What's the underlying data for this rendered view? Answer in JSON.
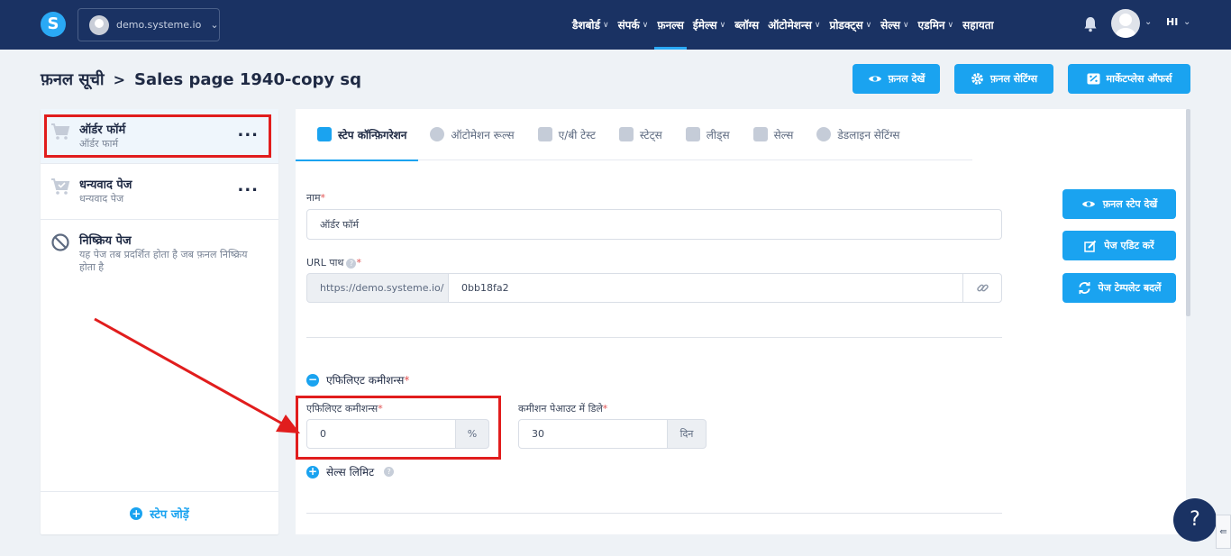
{
  "topbar": {
    "logo_letter": "S",
    "workspace": "demo.systeme.io",
    "nav": [
      {
        "label": "डैशबोर्ड",
        "caret": true,
        "active": false
      },
      {
        "label": "संपर्क",
        "caret": true,
        "active": false
      },
      {
        "label": "फ़नल्स",
        "caret": false,
        "active": true
      },
      {
        "label": "ईमेल्स",
        "caret": true,
        "active": false
      },
      {
        "label": "ब्लॉग्स",
        "caret": false,
        "active": false
      },
      {
        "label": "ऑटोमेशन्स",
        "caret": true,
        "active": false
      },
      {
        "label": "प्रोडक्ट्स",
        "caret": true,
        "active": false
      },
      {
        "label": "सेल्स",
        "caret": true,
        "active": false
      },
      {
        "label": "एडमिन",
        "caret": true,
        "active": false
      },
      {
        "label": "सहायता",
        "caret": false,
        "active": false
      }
    ],
    "language": "HI",
    "accent": "#2aa9f5",
    "background": "#1a3263"
  },
  "header": {
    "breadcrumb_root": "फ़नल सूची",
    "breadcrumb_sep": ">",
    "breadcrumb_current": "Sales page 1940-copy sq",
    "buttons": {
      "view_funnel": "फ़नल देखें",
      "funnel_settings": "फ़नल सेटिंग्स",
      "marketplace_offers": "मार्केटप्लेस ऑफर्स"
    }
  },
  "steps": [
    {
      "title": "ऑर्डर फॉर्म",
      "subtitle": "ऑर्डर फार्म",
      "more": "..."
    },
    {
      "title": "धन्यवाद पेज",
      "subtitle": "धन्यवाद पेज",
      "more": "..."
    },
    {
      "title": "निष्क्रिय पेज",
      "subtitle": "यह पेज तब प्रदर्शित होता है जब फ़नल निष्क्रिय होता है"
    }
  ],
  "add_step": "स्टेप जोड़ें",
  "tabs": [
    {
      "label": "स्टेप कॉन्फ़िगरेशन",
      "active": true
    },
    {
      "label": "ऑटोमेशन रूल्स",
      "active": false
    },
    {
      "label": "ए/बी टेस्ट",
      "active": false
    },
    {
      "label": "स्टेट्स",
      "active": false
    },
    {
      "label": "लीड्स",
      "active": false
    },
    {
      "label": "सेल्स",
      "active": false
    },
    {
      "label": "डेडलाइन सेटिंग्स",
      "active": false
    }
  ],
  "form": {
    "name_label": "नाम",
    "name_value": "ऑर्डर फॉर्म",
    "url_label": "URL पाथ",
    "url_prefix": "https://demo.systeme.io/",
    "url_value": "0bb18fa2",
    "affiliate_section": "एफिलिएट कमीशन्स",
    "affiliate_label": "एफिलिएट कमीशन्स",
    "affiliate_value": "0",
    "affiliate_unit": "%",
    "delay_label": "कमीशन पेआउट में डिले",
    "delay_value": "30",
    "delay_unit": "दिन",
    "sales_limit": "सेल्स लिमिट",
    "required_mark": "*",
    "help_mark": "?"
  },
  "side_buttons": {
    "view_step": "फ़नल स्टेप देखें",
    "edit_page": "पेज एडिट करें",
    "change_template": "पेज टेम्पलेट बदलें"
  },
  "help_fab": "?",
  "annotation_color": "#e11d1d"
}
